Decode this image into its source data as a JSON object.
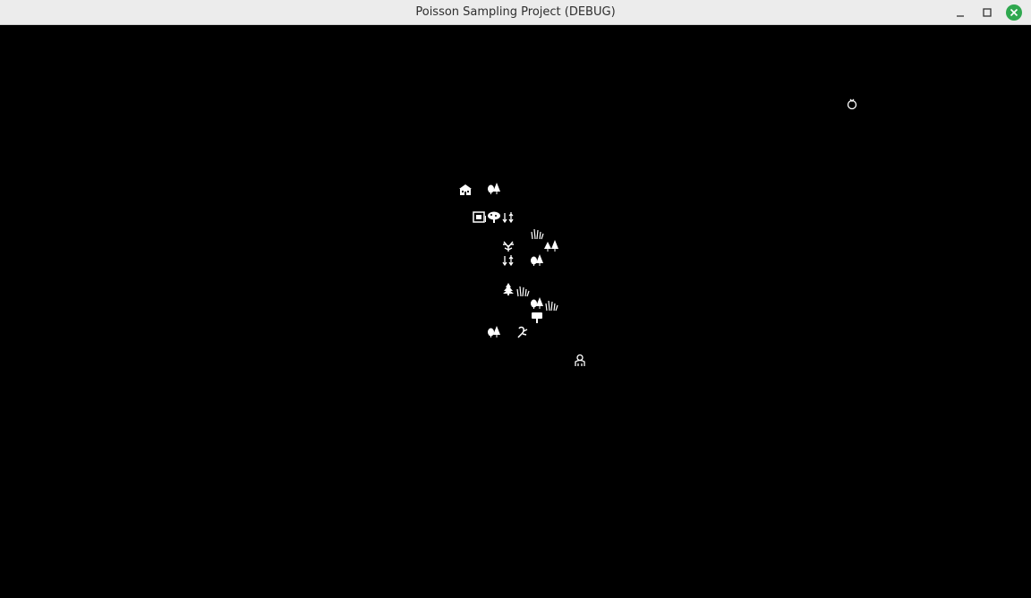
{
  "window": {
    "title": "Poisson Sampling Project (DEBUG)",
    "buttons": {
      "minimize": "minimize-icon",
      "maximize": "maximize-icon",
      "close": "close-icon"
    },
    "close_color": "#2fa84f"
  },
  "scene": {
    "background": "#000000",
    "sprite_color": "#ffffff",
    "sprites": [
      "house",
      "trees",
      "shop-sign",
      "mushroom-tree",
      "sapling",
      "grass-tuft",
      "trees",
      "dead-bush",
      "sapling",
      "trees",
      "pine-tree",
      "grass-tuft",
      "trees",
      "grass-tuft",
      "signpost",
      "trees",
      "vine",
      "player-character",
      "cursor-marker"
    ]
  }
}
